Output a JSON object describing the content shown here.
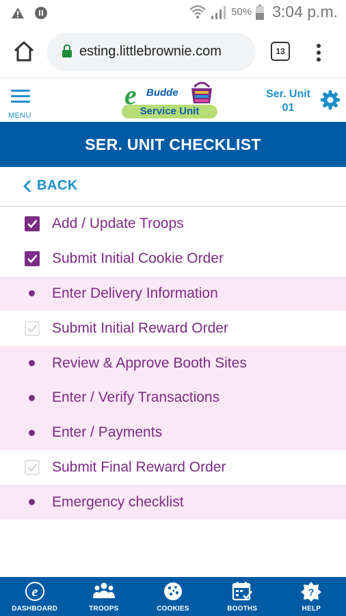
{
  "status_bar": {
    "battery_percent": "50%",
    "time": "3:04 p.m.",
    "icons": [
      "alert-icon",
      "pause-circle-icon",
      "wifi-icon",
      "signal-icon",
      "battery-icon"
    ]
  },
  "browser": {
    "url": "esting.littlebrownie.com",
    "tab_count": "13"
  },
  "header": {
    "menu_label": "MENU",
    "logo_e": "e",
    "logo_name": "Budde",
    "logo_banner": "Service Unit",
    "unit_line1": "Ser. Unit",
    "unit_line2": "01"
  },
  "page": {
    "title": "SER. UNIT CHECKLIST",
    "back_label": "BACK"
  },
  "checklist": [
    {
      "label": "Add / Update Troops",
      "marker": "checked",
      "highlight": false
    },
    {
      "label": "Submit Initial Cookie Order",
      "marker": "checked",
      "highlight": false
    },
    {
      "label": "Enter Delivery Information",
      "marker": "bullet",
      "highlight": true
    },
    {
      "label": "Submit Initial Reward Order",
      "marker": "faint-check",
      "highlight": false
    },
    {
      "label": "Review & Approve Booth Sites",
      "marker": "bullet",
      "highlight": true
    },
    {
      "label": "Enter / Verify Transactions",
      "marker": "bullet",
      "highlight": true
    },
    {
      "label": "Enter / Payments",
      "marker": "bullet",
      "highlight": true
    },
    {
      "label": "Submit Final Reward Order",
      "marker": "faint-check",
      "highlight": false
    },
    {
      "label": "Emergency checklist",
      "marker": "bullet",
      "highlight": true
    }
  ],
  "bottom_nav": [
    {
      "label": "DASHBOARD",
      "icon": "e-logo-icon"
    },
    {
      "label": "TROOPS",
      "icon": "people-icon"
    },
    {
      "label": "COOKIES",
      "icon": "cookie-icon"
    },
    {
      "label": "BOOTHS",
      "icon": "calendar-check-icon"
    },
    {
      "label": "HELP",
      "icon": "help-badge-icon"
    }
  ],
  "colors": {
    "primary_blue": "#005ba5",
    "accent_blue": "#1d8fc9",
    "purple": "#7b2c83",
    "pink_row": "#fbe8f7",
    "logo_green": "#b6dd76"
  }
}
